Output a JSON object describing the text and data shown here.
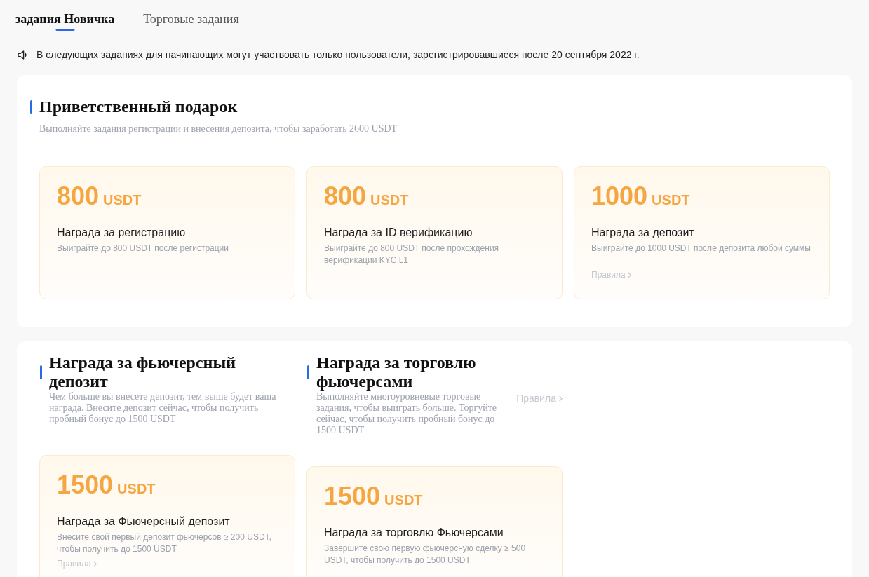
{
  "tabs": [
    {
      "label": "задания Новичка",
      "selected": true
    },
    {
      "label": "Торговые задания",
      "selected": false
    }
  ],
  "notice": {
    "text": "В следующих заданиях для начинающих могут участвовать только пользователи, зарегистрировавшиеся после 20 сентября 2022 г."
  },
  "welcome_gift": {
    "title": "Приветственный подарок",
    "subtitle": "Выполняйте задания регистрации и внесения депозита, чтобы заработать 2600 USDT",
    "rewards": [
      {
        "amount": "800",
        "currency": "USDT",
        "title": "Награда за регистрацию",
        "description": "Выиграйте до 800 USDT после регистрации"
      },
      {
        "amount": "800",
        "currency": "USDT",
        "title": "Награда за ID верификацию",
        "description": "Выиграйте до 800 USDT после прохождения верификации KYC L1"
      },
      {
        "amount": "1000",
        "currency": "USDT",
        "title": "Награда за депозит",
        "description": "Выиграйте до 1000 USDT после депозита любой суммы",
        "rules_link": "Правила"
      }
    ]
  },
  "futures_sections": [
    {
      "title": "Награда за фьючерсный депозит",
      "description": "Чем больше вы внесете депозит, тем выше будет ваша награда. Внесите депозит сейчас, чтобы получить пробный бонус до 1500 USDT",
      "reward": {
        "amount": "1500",
        "currency": "USDT",
        "title": "Награда за Фьючерсный депозит",
        "description": "Внесите свой первый депозит фьючерсов ≥ 200 USDT, чтобы получить до 1500 USDT",
        "rules_link": "Правила"
      }
    },
    {
      "title": "Награда за торговлю фьючерсами",
      "description": "Выполняйте многоуровневые торговые задания, чтобы выиграть больше. Торгуйте сейчас, чтобы получить пробный бонус до 1500 USDT",
      "rules_link": "Правила",
      "reward": {
        "amount": "1500",
        "currency": "USDT",
        "title": "Награда за торговлю Фьючерсами",
        "description": "Завершите свою первую фьючерсную сделку ≥ 500 USDT, чтобы получить до 1500 USDT"
      }
    }
  ]
}
